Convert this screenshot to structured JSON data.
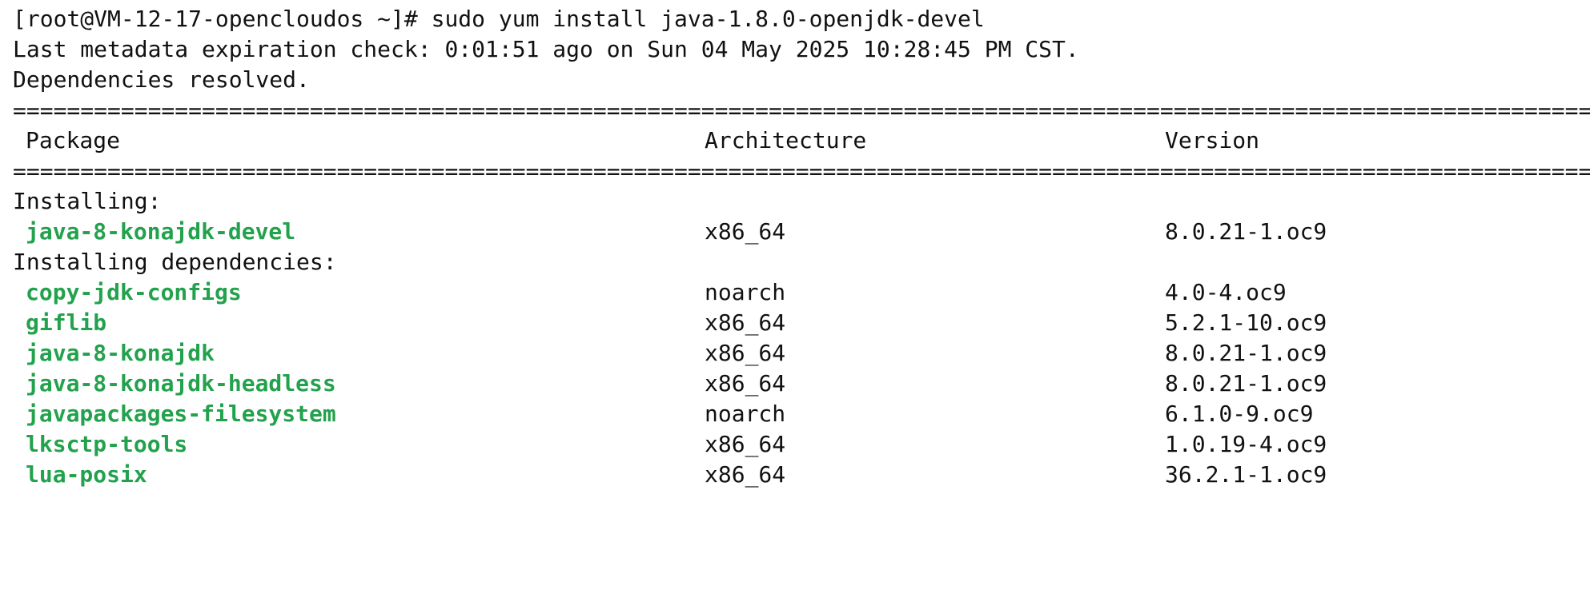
{
  "terminal": {
    "command_line": "[root@VM-12-17-opencloudos ~]# sudo yum install java-1.8.0-openjdk-devel",
    "metadata_line": "Last metadata expiration check: 0:01:51 ago on Sun 04 May 2025 10:28:45 PM CST.",
    "resolved_line": "Dependencies resolved.",
    "separator": "=================================================================================================================================================================================================================================",
    "headers": {
      "package": "Package",
      "architecture": "Architecture",
      "version": "Version"
    },
    "installing_label": "Installing:",
    "installing": [
      {
        "name": "java-8-konajdk-devel",
        "arch": "x86_64",
        "version": "8.0.21-1.oc9"
      }
    ],
    "deps_label": "Installing dependencies:",
    "dependencies": [
      {
        "name": "copy-jdk-configs",
        "arch": "noarch",
        "version": "4.0-4.oc9"
      },
      {
        "name": "giflib",
        "arch": "x86_64",
        "version": "5.2.1-10.oc9"
      },
      {
        "name": "java-8-konajdk",
        "arch": "x86_64",
        "version": "8.0.21-1.oc9"
      },
      {
        "name": "java-8-konajdk-headless",
        "arch": "x86_64",
        "version": "8.0.21-1.oc9"
      },
      {
        "name": "javapackages-filesystem",
        "arch": "noarch",
        "version": "6.1.0-9.oc9"
      },
      {
        "name": "lksctp-tools",
        "arch": "x86_64",
        "version": "1.0.19-4.oc9"
      },
      {
        "name": "lua-posix",
        "arch": "x86_64",
        "version": "36.2.1-1.oc9"
      }
    ],
    "colors": {
      "package_name": "#23a24d",
      "text": "#111111",
      "background": "#ffffff"
    }
  }
}
